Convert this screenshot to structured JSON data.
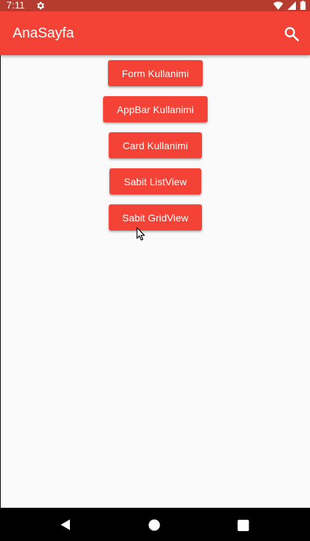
{
  "status_bar": {
    "time": "7:11",
    "icons": [
      "settings-icon",
      "wifi-icon",
      "signal-icon",
      "battery-icon"
    ]
  },
  "app_bar": {
    "title": "AnaSayfa",
    "action_icon": "search-icon",
    "color": "#f44336"
  },
  "buttons": [
    {
      "label": "Form Kullanimi"
    },
    {
      "label": "AppBar Kullanimi"
    },
    {
      "label": "Card Kullanimi"
    },
    {
      "label": "Sabit ListView"
    },
    {
      "label": "Sabit GridView"
    }
  ],
  "nav_bar": {
    "icons": [
      "back-icon",
      "home-icon",
      "recents-icon"
    ]
  }
}
